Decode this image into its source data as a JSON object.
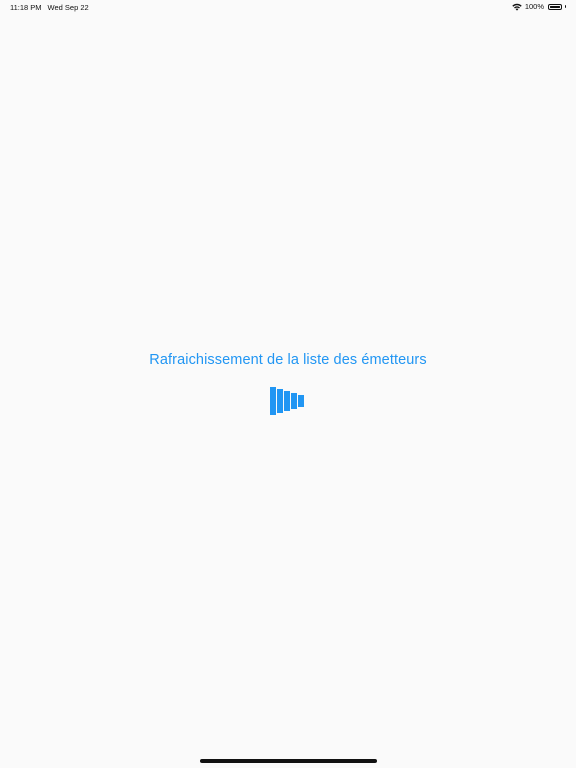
{
  "status_bar": {
    "time": "11:18 PM",
    "date": "Wed Sep 22",
    "battery_text": "100%",
    "battery_level": 1.0,
    "wifi_icon": "wifi-icon",
    "battery_icon": "battery-icon"
  },
  "loading": {
    "message": "Rafraichissement de la liste des émetteurs",
    "spinner_icon": "loading-bars-icon",
    "accent_color": "#2196f3"
  },
  "colors": {
    "background": "#fafafa",
    "text": "#111111",
    "accent": "#2196f3"
  }
}
